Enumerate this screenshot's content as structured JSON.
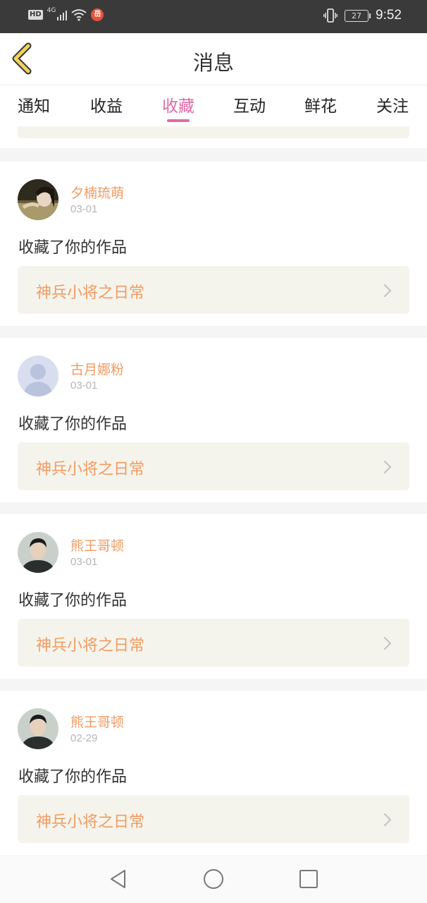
{
  "status_bar": {
    "hd_badge": "HD",
    "network_type": "4G",
    "notification_app_badge": "岳",
    "battery_level": "27",
    "time": "9:52"
  },
  "header": {
    "title": "消息"
  },
  "tabs": [
    {
      "label": "通知",
      "active": false
    },
    {
      "label": "收益",
      "active": false
    },
    {
      "label": "收藏",
      "active": true
    },
    {
      "label": "互动",
      "active": false
    },
    {
      "label": "鲜花",
      "active": false
    },
    {
      "label": "关注",
      "active": false
    }
  ],
  "messages": [
    {
      "user": "夕楠琉萌",
      "date": "03-01",
      "action": "收藏了你的作品",
      "work": "神兵小将之日常",
      "avatar": "photo-girl"
    },
    {
      "user": "古月娜粉",
      "date": "03-01",
      "action": "收藏了你的作品",
      "work": "神兵小将之日常",
      "avatar": "default-placeholder"
    },
    {
      "user": "熊王哥顿",
      "date": "03-01",
      "action": "收藏了你的作品",
      "work": "神兵小将之日常",
      "avatar": "photo-man"
    },
    {
      "user": "熊王哥顿",
      "date": "02-29",
      "action": "收藏了你的作品",
      "work": "神兵小将之日常",
      "avatar": "photo-man"
    }
  ],
  "colors": {
    "accent_pink": "#e06aa5",
    "name_orange": "#f19b62",
    "back_arrow_yellow": "#f0d25a",
    "card_link_bg": "#f5f4ec",
    "status_bar_bg": "#3a3a3a"
  }
}
